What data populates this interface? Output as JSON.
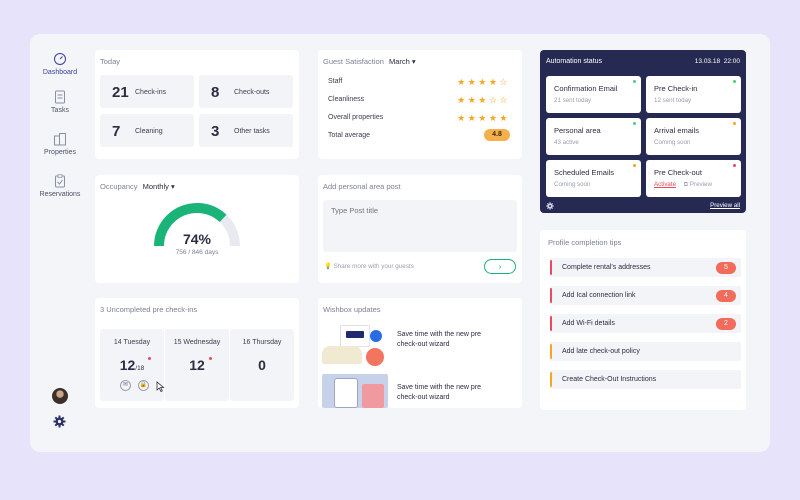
{
  "sidebar": {
    "items": [
      {
        "label": "Dashboard",
        "icon": "dashboard-icon",
        "active": true
      },
      {
        "label": "Tasks",
        "icon": "tasks-icon"
      },
      {
        "label": "Properties",
        "icon": "properties-icon"
      },
      {
        "label": "Reservations",
        "icon": "reservations-icon"
      }
    ]
  },
  "today": {
    "title": "Today",
    "stats": [
      {
        "value": "21",
        "label": "Check-ins"
      },
      {
        "value": "8",
        "label": "Check-outs"
      },
      {
        "value": "7",
        "label": "Cleaning"
      },
      {
        "value": "3",
        "label": "Other tasks"
      }
    ]
  },
  "satisfaction": {
    "title": "Guest Satisfaction",
    "month": "March",
    "rows": [
      {
        "label": "Staff",
        "stars": 4
      },
      {
        "label": "Cleanliness",
        "stars": 3
      },
      {
        "label": "Overall properties",
        "stars": 5
      }
    ],
    "total_label": "Total average",
    "total_value": "4.8"
  },
  "automation": {
    "title": "Automation status",
    "date": "13.03.18",
    "time": "22:00",
    "tiles": [
      {
        "title": "Confirmation Email",
        "sub": "21 sent today",
        "dot": "#4cd07d"
      },
      {
        "title": "Pre Check-in",
        "sub": "12 sent today",
        "dot": "#4cd07d"
      },
      {
        "title": "Personal area",
        "sub": "43 active",
        "dot": "#4cd07d"
      },
      {
        "title": "Arrival emails",
        "sub": "Coming soon",
        "dot": "#f5a623"
      },
      {
        "title": "Scheduled Emails",
        "sub": "Coming soon",
        "dot": "#f5a623"
      },
      {
        "title": "Pre Check-out",
        "activate": "Activate",
        "preview": "Preview",
        "dot": "#e84a5f"
      }
    ],
    "preview_all": "Preview all"
  },
  "occupancy": {
    "title": "Occupancy",
    "period": "Monthly",
    "percent": "74%",
    "fraction": 0.74,
    "detail": "756 / 846 days"
  },
  "post": {
    "title": "Add personal area post",
    "placeholder": "Type Post title",
    "hint": "Share more with your guests"
  },
  "tips": {
    "title": "Profile completion tips",
    "items": [
      {
        "label": "Complete rental's addresses",
        "badge": "5",
        "color": "#e84a5f"
      },
      {
        "label": "Add Ical connection link",
        "badge": "4",
        "color": "#e84a5f"
      },
      {
        "label": "Add Wi-Fi details",
        "badge": "2",
        "color": "#e84a5f"
      },
      {
        "label": "Add late check-out policy",
        "badge": "",
        "color": "#f5a623"
      },
      {
        "label": "Create Check-Out Instructions",
        "badge": "",
        "color": "#f5a623"
      }
    ]
  },
  "checkins": {
    "title": "3 Uncompleted pre check-ins",
    "days": [
      {
        "label": "14 Tuesday",
        "value": "12",
        "sub": "/18"
      },
      {
        "label": "15 Wednesday",
        "value": "12",
        "sub": ""
      },
      {
        "label": "16 Thursday",
        "value": "0",
        "sub": ""
      }
    ]
  },
  "wishbox": {
    "title": "Wishbox updates",
    "items": [
      {
        "text": "Save time with the new pre check-out wizard"
      },
      {
        "text": "Save time with the new pre check-out wizard"
      }
    ]
  }
}
